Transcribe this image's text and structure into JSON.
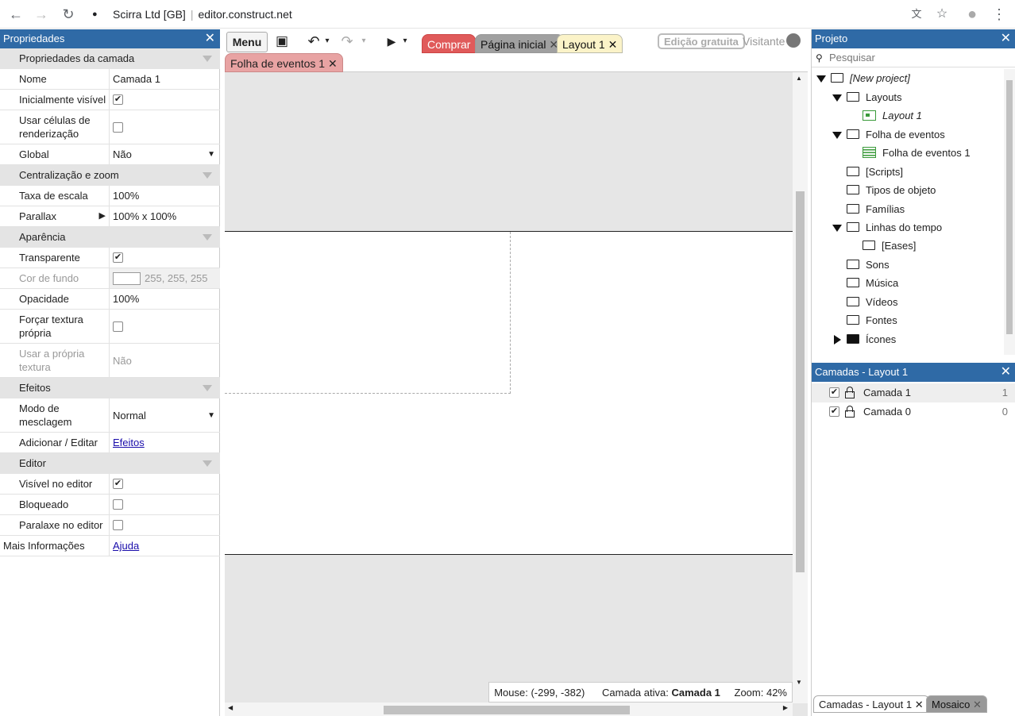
{
  "browser": {
    "site_name": "Scirra Ltd [GB]",
    "url": "editor.construct.net",
    "back_icon": "←",
    "forward_icon": "→",
    "reload_icon": "↻",
    "lock_icon": "🔒",
    "translate_icon": "文",
    "star_icon": "☆",
    "profile_icon": "●",
    "menu_icon": "⋮"
  },
  "properties": {
    "title": "Propriedades",
    "close": "✕",
    "sections": {
      "layer": "Propriedades da camada",
      "centering": "Centralização e zoom",
      "appearance": "Aparência",
      "effects": "Efeitos",
      "editor": "Editor"
    },
    "rows": {
      "name_label": "Nome",
      "name_value": "Camada 1",
      "init_visible_label": "Inicialmente visível",
      "render_cells_label": "Usar células de renderização",
      "global_label": "Global",
      "global_value": "Não",
      "scale_rate_label": "Taxa de escala",
      "scale_rate_value": "100%",
      "parallax_label": "Parallax",
      "parallax_value": "100% x 100%",
      "transparent_label": "Transparente",
      "bg_color_label": "Cor de fundo",
      "bg_color_value": "255, 255, 255",
      "opacity_label": "Opacidade",
      "opacity_value": "100%",
      "force_texture_label": "Forçar textura própria",
      "own_texture_label": "Usar a própria textura",
      "own_texture_value": "Não",
      "blend_label": "Modo de mesclagem",
      "blend_value": "Normal",
      "add_edit_label": "Adicionar / Editar",
      "add_edit_link": "Efeitos",
      "visible_editor_label": "Visível no editor",
      "locked_label": "Bloqueado",
      "parallax_editor_label": "Paralaxe no editor",
      "more_info_label": "Mais Informações",
      "more_info_link": "Ajuda"
    },
    "checkbox_states": {
      "init_visible": true,
      "render_cells": false,
      "transparent": true,
      "force_texture": false,
      "visible_editor": true,
      "locked": false,
      "parallax_editor": false
    }
  },
  "toolbar": {
    "menu": "Menu",
    "save_icon": "💾",
    "undo_icon": "↶",
    "redo_icon": "↷",
    "play_icon": "▶",
    "dropdown_icon": "▾",
    "tabs": {
      "buy": "Comprar",
      "home": "Página inicial",
      "layout": "Layout 1",
      "event_sheet": "Folha de eventos 1"
    },
    "free_edition": "Edição gratuita",
    "guest": "Visitante",
    "tab_close": "✕"
  },
  "status": {
    "mouse_label": "Mouse: (-299, -382)",
    "active_layer_label": "Camada ativa:",
    "active_layer_value": "Camada 1",
    "zoom_label": "Zoom: 42%"
  },
  "project": {
    "title": "Projeto",
    "close": "✕",
    "search_placeholder": "Pesquisar",
    "tree": {
      "root": "[New project]",
      "layouts": "Layouts",
      "layout1": "Layout 1",
      "event_sheets": "Folha de eventos",
      "event_sheet1": "Folha de eventos 1",
      "scripts": "[Scripts]",
      "object_types": "Tipos de objeto",
      "families": "Famílias",
      "timelines": "Linhas do tempo",
      "eases": "[Eases]",
      "sounds": "Sons",
      "music": "Música",
      "videos": "Vídeos",
      "fonts": "Fontes",
      "icons": "Ícones"
    }
  },
  "layers": {
    "title": "Camadas - Layout 1",
    "close": "✕",
    "items": [
      {
        "name": "Camada 1",
        "index": "1"
      },
      {
        "name": "Camada 0",
        "index": "0"
      }
    ],
    "bottom_tabs": {
      "layers": "Camadas - Layout 1",
      "tilemap": "Mosaico"
    }
  },
  "colors": {
    "panel_header": "#2f6aa6",
    "buy_tab": "#e05a5a",
    "layout_tab": "#fbf3c8",
    "event_tab": "#e8a3a3",
    "home_tab": "#a0a0a0"
  }
}
